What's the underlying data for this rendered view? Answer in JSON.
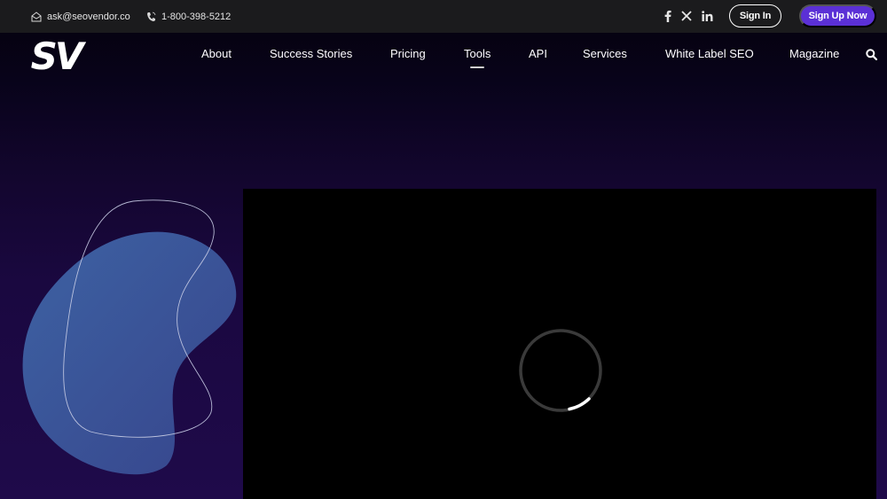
{
  "topbar": {
    "email": "ask@seovendor.co",
    "phone": "1-800-398-5212",
    "social": [
      "facebook-icon",
      "x-icon",
      "linkedin-icon"
    ],
    "sign_in_label": "Sign In",
    "sign_up_label": "Sign Up Now"
  },
  "header": {
    "logo_text": "SV",
    "nav": [
      {
        "label": "About"
      },
      {
        "label": "Success Stories"
      },
      {
        "label": "Pricing"
      },
      {
        "label": "Tools"
      },
      {
        "label": "API"
      },
      {
        "label": "Services"
      },
      {
        "label": "White Label SEO"
      },
      {
        "label": "Magazine"
      }
    ],
    "active_nav": "Tools"
  },
  "colors": {
    "accent": "#5b30d6",
    "topbar_bg": "#1b1b1d",
    "blob": "#3b5a9c"
  }
}
